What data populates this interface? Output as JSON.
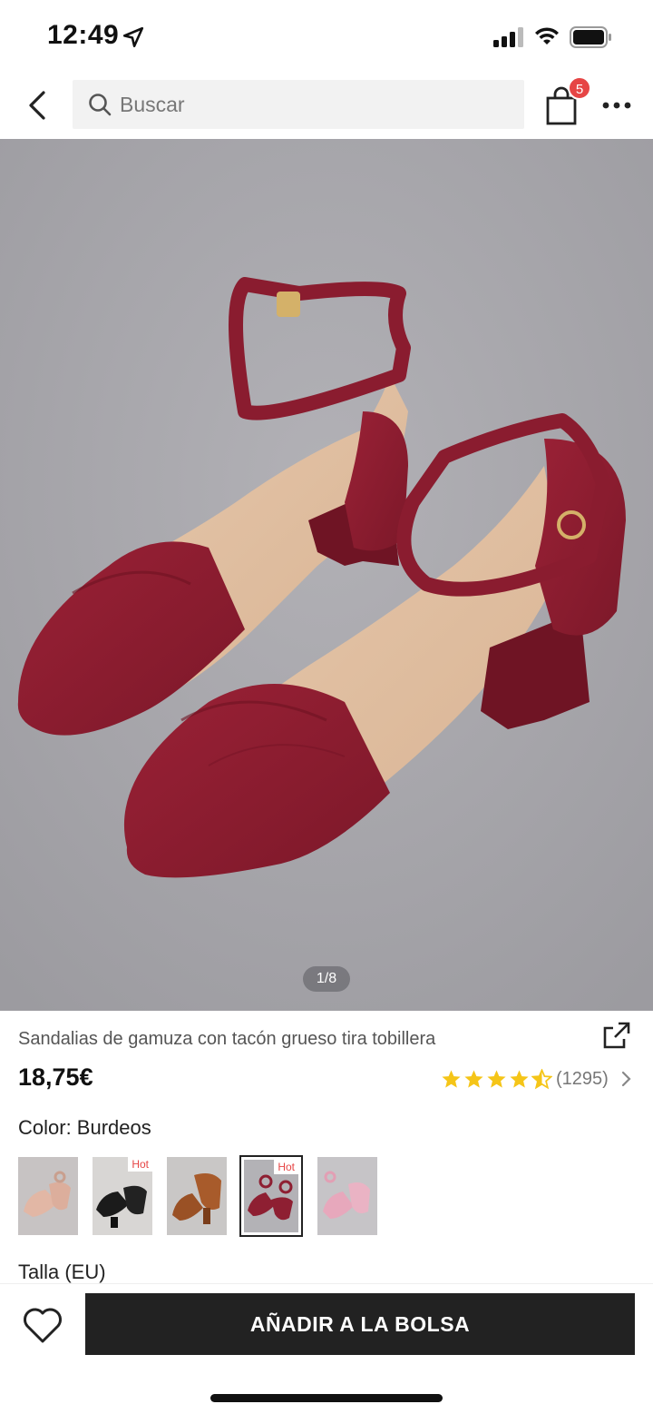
{
  "status_bar": {
    "time": "12:49",
    "icons": [
      "location-arrow-icon",
      "cellular-signal-icon",
      "wifi-icon",
      "battery-icon"
    ]
  },
  "nav": {
    "back_icon": "chevron-left-icon",
    "search_placeholder": "Buscar",
    "bag_icon": "shopping-bag-icon",
    "bag_count": "5",
    "more_icon": "more-horizontal-icon"
  },
  "gallery": {
    "pager": "1/8"
  },
  "product": {
    "title": "Sandalias de gamuza con tacón grueso tira tobillera",
    "price": "18,75€",
    "rating": 4.5,
    "rating_count": "(1295)",
    "share_icon": "share-external-icon"
  },
  "colors": {
    "label": "Color: Burdeos",
    "swatches": [
      {
        "name": "nude",
        "hot": ""
      },
      {
        "name": "black",
        "hot": "Hot"
      },
      {
        "name": "brown",
        "hot": ""
      },
      {
        "name": "burgundy",
        "hot": "Hot",
        "selected": true
      },
      {
        "name": "pink",
        "hot": ""
      }
    ]
  },
  "size": {
    "label": "Talla (EU)"
  },
  "bottom_bar": {
    "wishlist_icon": "heart-outline-icon",
    "add_to_bag_label": "AÑADIR A LA BOLSA"
  },
  "colors_theme": {
    "accent_red": "#e64545",
    "star_yellow": "#f5c518",
    "button_dark": "#222222",
    "burgundy": "#8e1f32"
  }
}
